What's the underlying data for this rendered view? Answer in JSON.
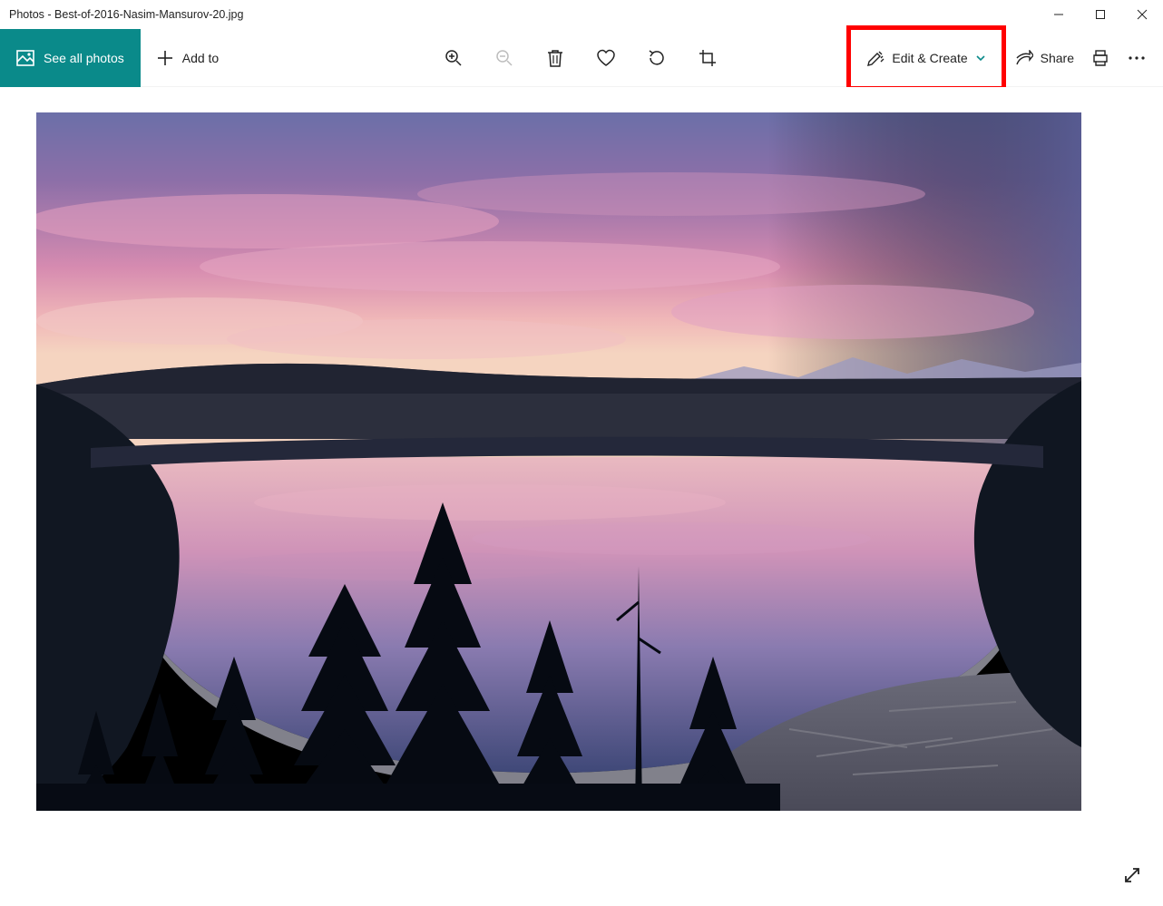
{
  "titlebar": {
    "title": "Photos - Best-of-2016-Nasim-Mansurov-20.jpg"
  },
  "toolbar": {
    "see_all_label": "See all photos",
    "add_to_label": "Add to",
    "edit_create_label": "Edit & Create",
    "share_label": "Share"
  },
  "icons": {
    "photo": "photo-icon",
    "plus": "plus-icon",
    "zoom_in": "zoom-in-icon",
    "zoom_out": "zoom-out-icon",
    "delete": "delete-icon",
    "heart": "heart-icon",
    "rotate": "rotate-icon",
    "crop": "crop-icon",
    "edit": "edit-icon",
    "chevron_down": "chevron-down-icon",
    "share": "share-icon",
    "print": "print-icon",
    "more": "more-icon",
    "minimize": "minimize-icon",
    "maximize": "maximize-icon",
    "close": "close-icon",
    "expand": "expand-icon"
  },
  "colors": {
    "accent": "#0a8a8a",
    "highlight": "#ff0000"
  },
  "photo": {
    "description": "Sunset over a mountain lake with pink and purple sky, silhouetted pine trees, calm reflective water, distant mountain range"
  }
}
